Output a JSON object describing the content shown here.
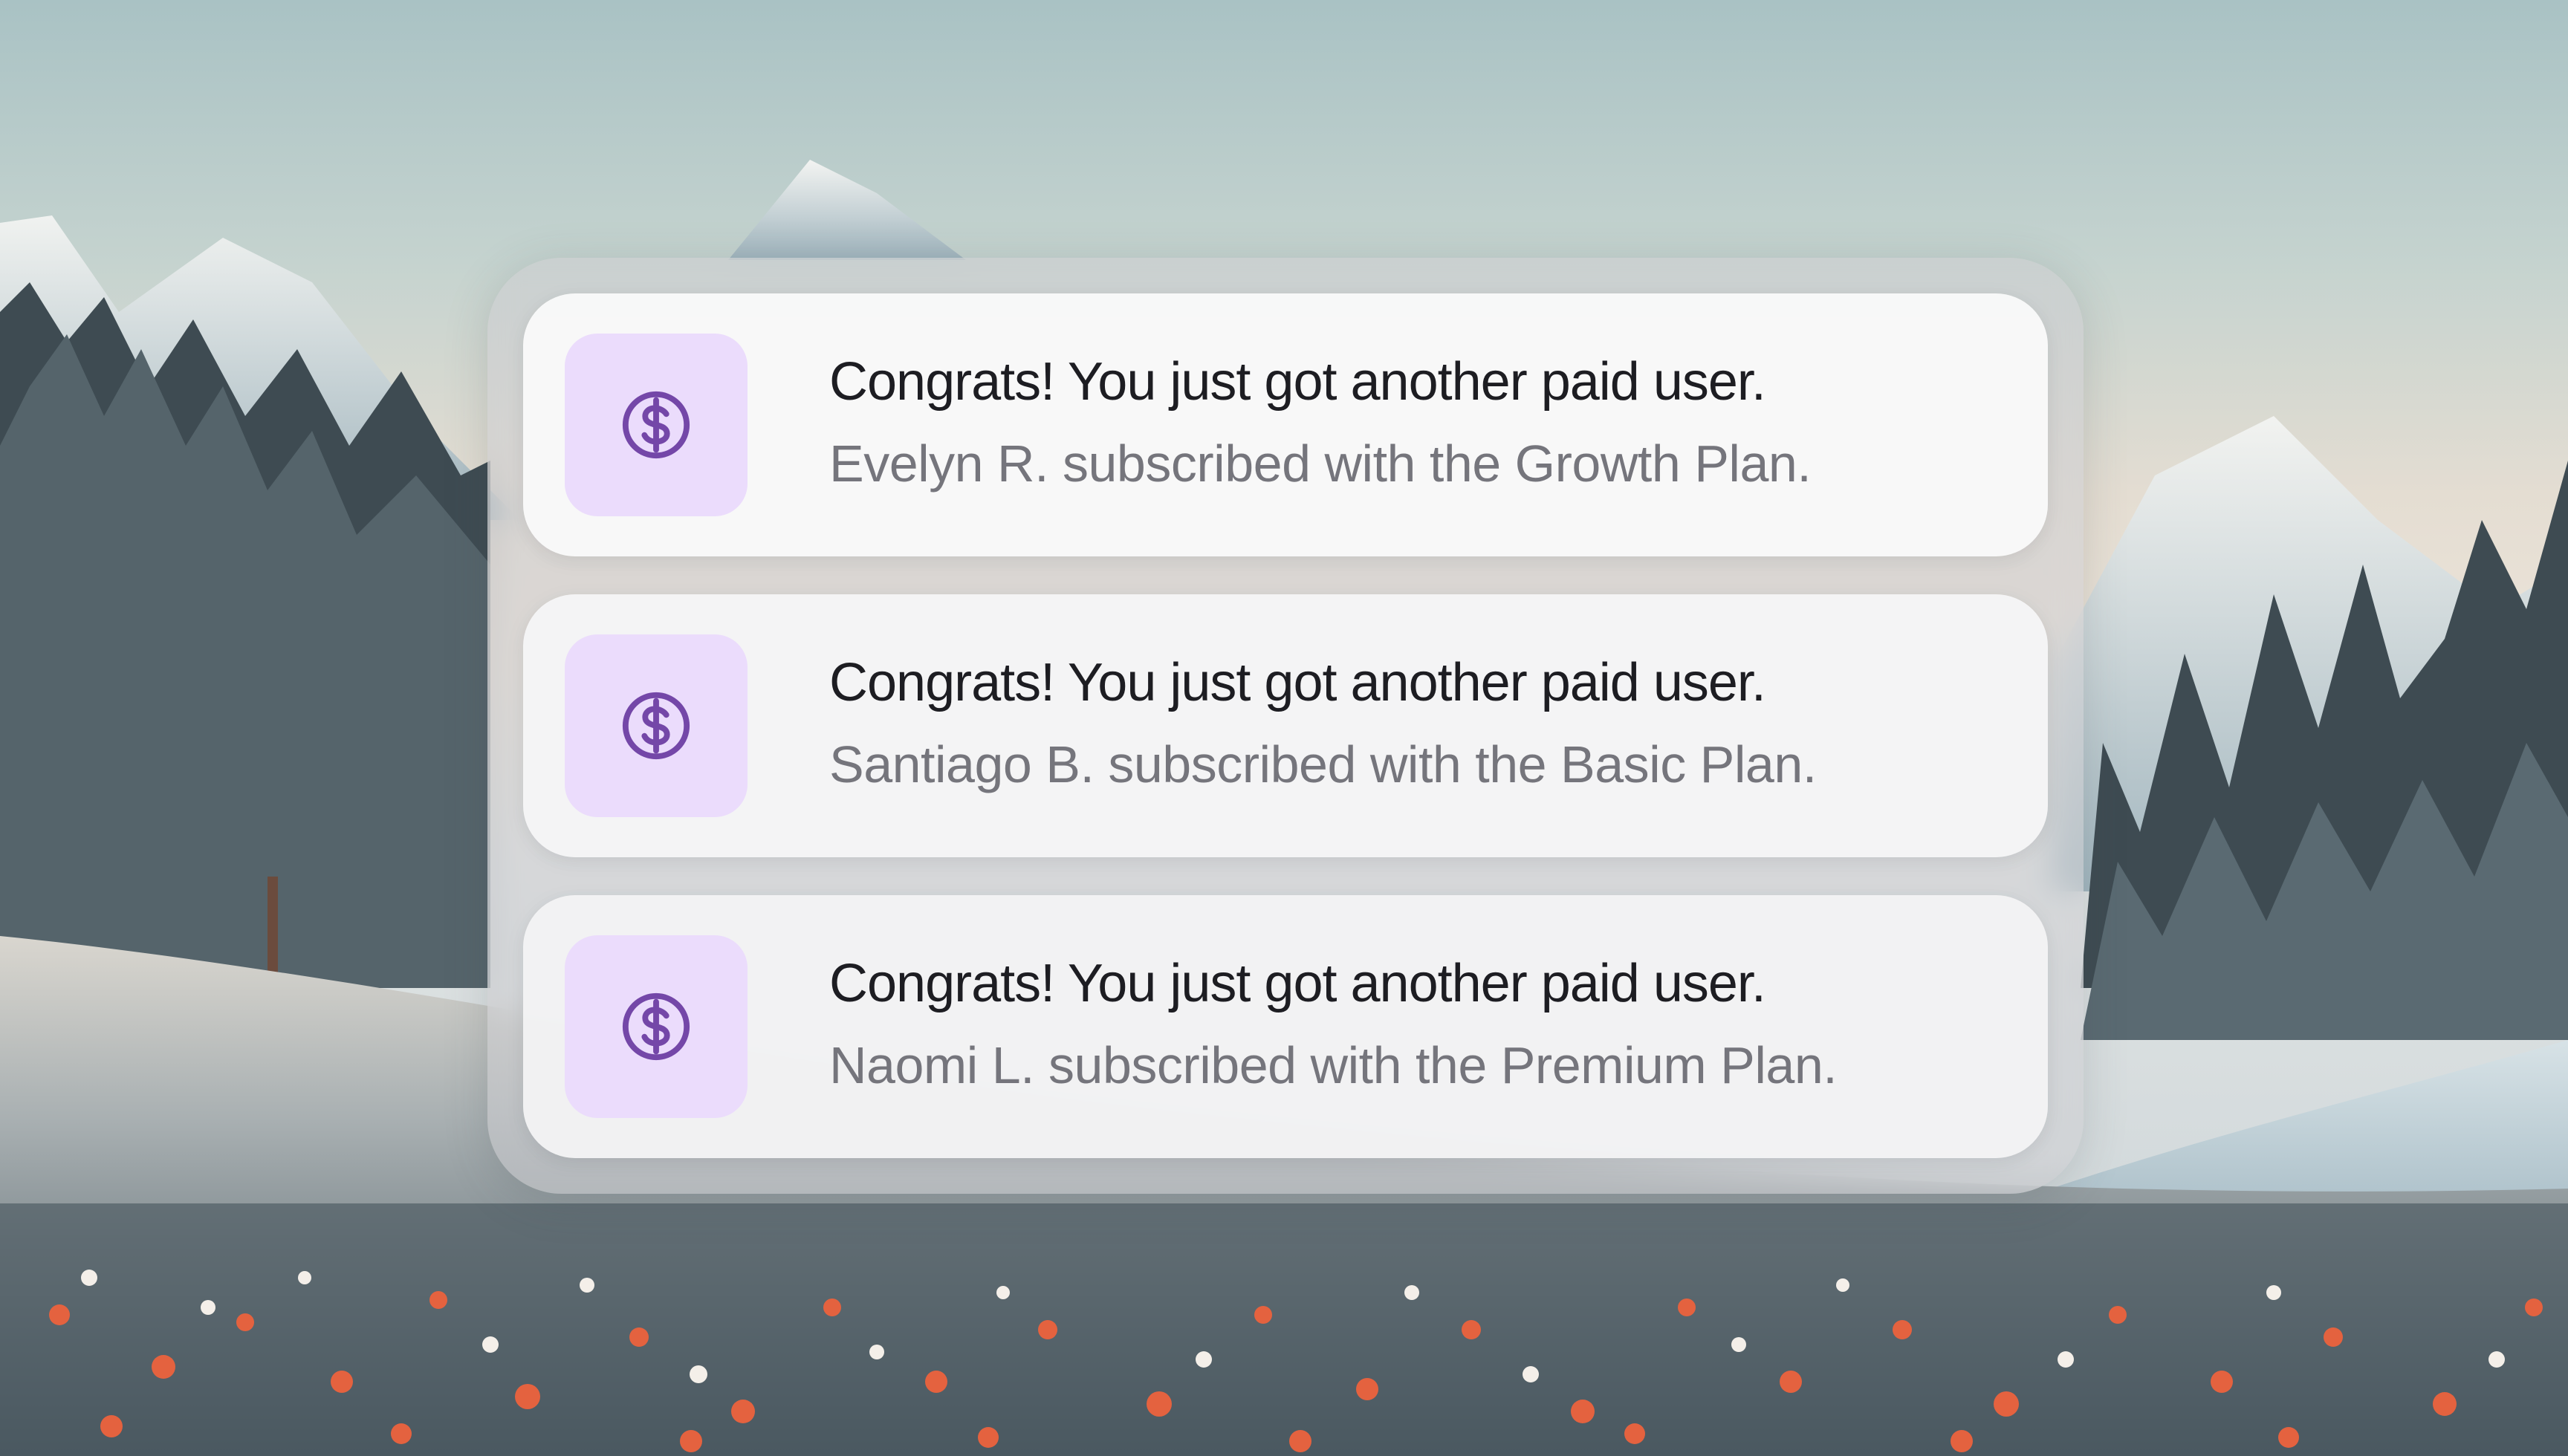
{
  "notifications": [
    {
      "icon": "dollar-circle-icon",
      "title": "Congrats! You just got another paid user.",
      "message": "Evelyn R. subscribed with the Growth Plan."
    },
    {
      "icon": "dollar-circle-icon",
      "title": "Congrats! You just got another paid user.",
      "message": "Santiago B. subscribed with the Basic Plan."
    },
    {
      "icon": "dollar-circle-icon",
      "title": "Congrats! You just got another paid user.",
      "message": "Naomi L. subscribed with the Premium Plan."
    }
  ],
  "colors": {
    "icon_tile": "#ebdcfc",
    "icon": "#7447a8",
    "title_text": "#1d1d22",
    "message_text": "#75757c"
  }
}
